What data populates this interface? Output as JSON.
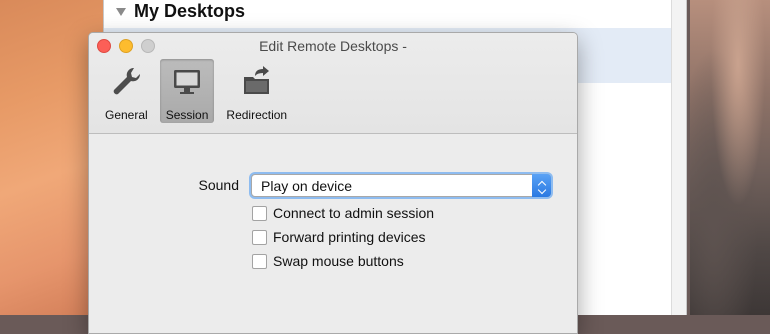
{
  "background_window": {
    "group_title": "My Desktops"
  },
  "dialog": {
    "title": "Edit Remote Desktops -",
    "tabs": [
      {
        "label": "General",
        "icon": "wrench-icon",
        "selected": false
      },
      {
        "label": "Session",
        "icon": "monitor-icon",
        "selected": true
      },
      {
        "label": "Redirection",
        "icon": "folder-redirect-icon",
        "selected": false
      }
    ],
    "sound": {
      "label": "Sound",
      "value": "Play on device"
    },
    "options": [
      {
        "label": "Connect to admin session",
        "checked": false
      },
      {
        "label": "Forward printing devices",
        "checked": false
      },
      {
        "label": "Swap mouse buttons",
        "checked": false
      }
    ]
  },
  "colors": {
    "accent": "#2a79e2",
    "close": "#fc5f57",
    "minimize": "#fdbc2e",
    "selection": "#e3ebf6"
  }
}
